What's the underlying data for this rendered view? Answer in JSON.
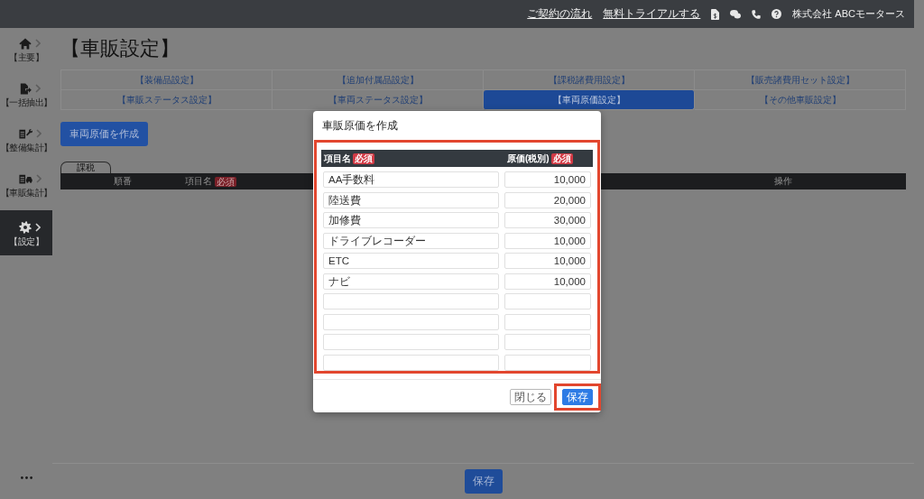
{
  "topbar": {
    "links": [
      {
        "label": "ご契約の流れ"
      },
      {
        "label": "無料トライアルする"
      }
    ],
    "company": "株式会社 ABCモータース"
  },
  "sidebar": {
    "items": [
      {
        "label": "【主要】",
        "selected": false
      },
      {
        "label": "【一括抽出】",
        "selected": false
      },
      {
        "label": "【整備集計】",
        "selected": false
      },
      {
        "label": "【車販集計】",
        "selected": false
      },
      {
        "label": "【設定】",
        "selected": true
      }
    ]
  },
  "page": {
    "title": "【車販設定】",
    "tabs": [
      {
        "label": "【装備品設定】",
        "selected": false
      },
      {
        "label": "【追加付属品設定】",
        "selected": false
      },
      {
        "label": "【課税諸費用設定】",
        "selected": false
      },
      {
        "label": "【販売諸費用セット設定】",
        "selected": false
      },
      {
        "label": "【車販ステータス設定】",
        "selected": false
      },
      {
        "label": "【車両ステータス設定】",
        "selected": false
      },
      {
        "label": "【車両原価設定】",
        "selected": true
      },
      {
        "label": "【その他車販設定】",
        "selected": false
      }
    ],
    "create_button": "車両原価を作成",
    "section_label": "課税",
    "table": {
      "columns": [
        {
          "label": "順番"
        },
        {
          "label": "項目名",
          "badge": "必須"
        },
        {
          "label": "操作"
        }
      ]
    },
    "save_button": "保存"
  },
  "modal": {
    "title": "車販原価を作成",
    "table": {
      "highlighted": true,
      "columns": [
        {
          "label": "項目名",
          "badge": "必須"
        },
        {
          "label": "原価(税別)",
          "badge": "必須"
        }
      ],
      "rows": [
        {
          "kind": "filled",
          "name": "AA手数料",
          "price": "10,000"
        },
        {
          "kind": "filled",
          "name": "陸送費",
          "price": "20,000"
        },
        {
          "kind": "filled",
          "name": "加修費",
          "price": "30,000"
        },
        {
          "kind": "filled",
          "name": "ドライブレコーダー",
          "price": "10,000"
        },
        {
          "kind": "filled",
          "name": "ETC",
          "price": "10,000"
        },
        {
          "kind": "filled",
          "name": "ナビ",
          "price": "10,000"
        },
        {
          "kind": "blank"
        },
        {
          "kind": "blank"
        },
        {
          "kind": "blank"
        },
        {
          "kind": "blank"
        }
      ]
    },
    "buttons": [
      {
        "label": "閉じる",
        "kind": "secondary",
        "highlighted": false
      },
      {
        "label": "保存",
        "kind": "primary",
        "highlighted": true
      }
    ]
  }
}
